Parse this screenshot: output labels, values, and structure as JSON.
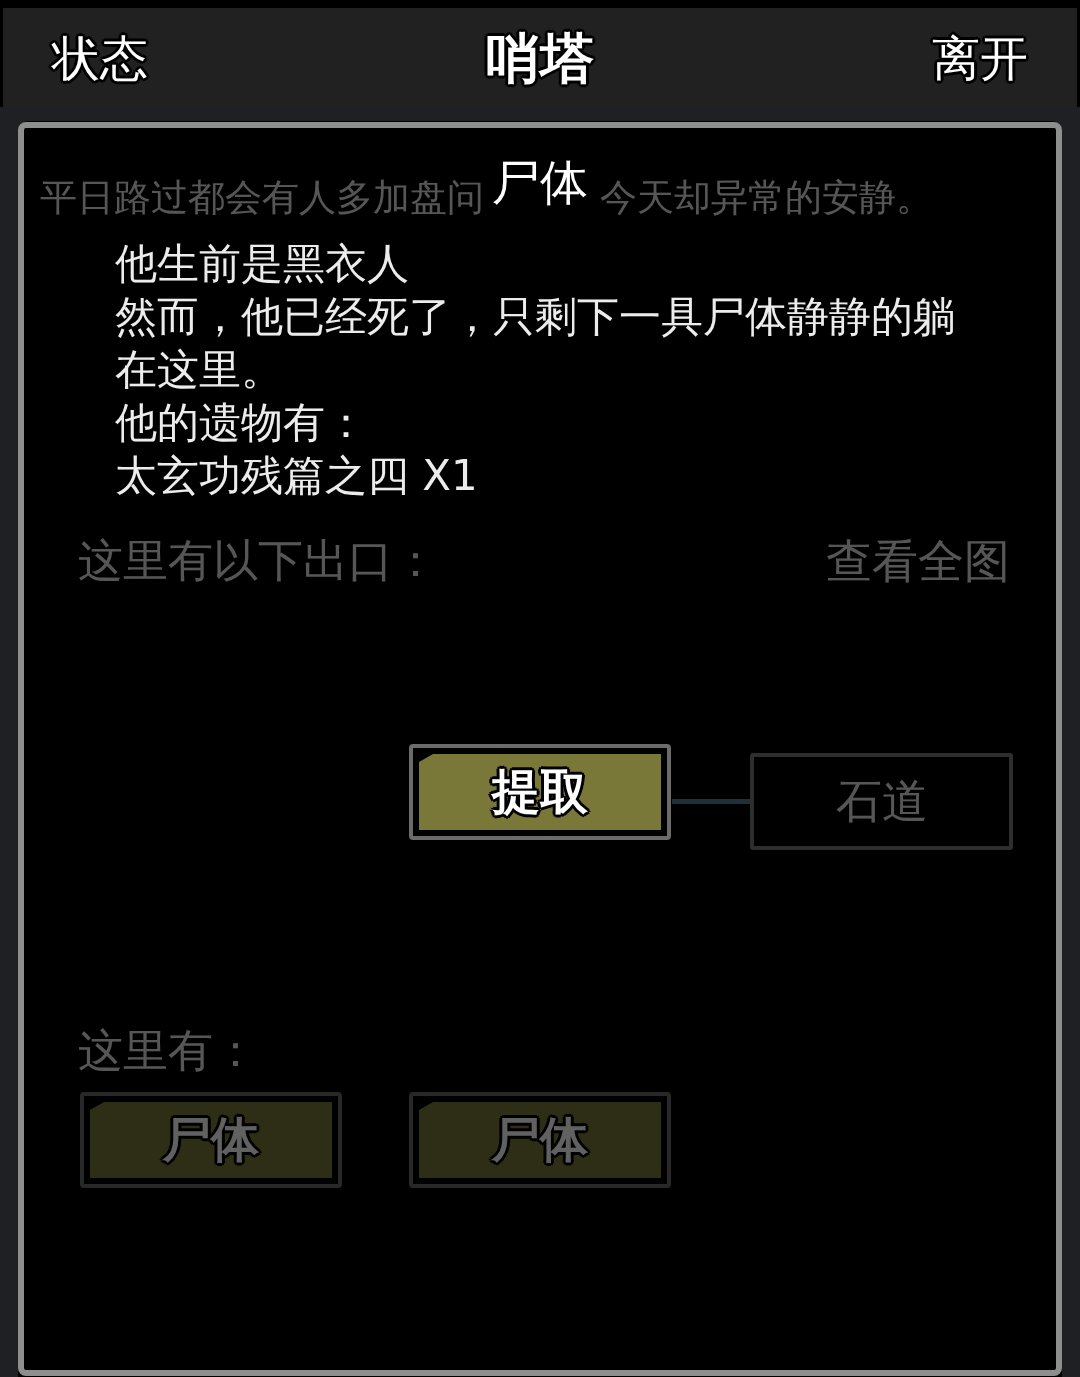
{
  "top_bar": {
    "left_button": "状态",
    "title": "哨塔",
    "right_button": "离开"
  },
  "background": {
    "description": [
      "平日路过都会有人多加盘问",
      "今天却异常的安静。"
    ],
    "exits_label": "这里有以下出口：",
    "map_link": "查看全图",
    "exits": [
      {
        "label": "石道"
      }
    ],
    "here_label": "这里有：",
    "items": [
      {
        "label": "尸体"
      },
      {
        "label": "尸体"
      }
    ]
  },
  "dialog": {
    "title": "尸体",
    "lines": [
      "他生前是黑衣人",
      "然而，他已经死了，只剩下一具尸体静静的躺在这里。",
      "他的遗物有：",
      "太玄功残篇之四 X1"
    ],
    "button": "提取"
  }
}
